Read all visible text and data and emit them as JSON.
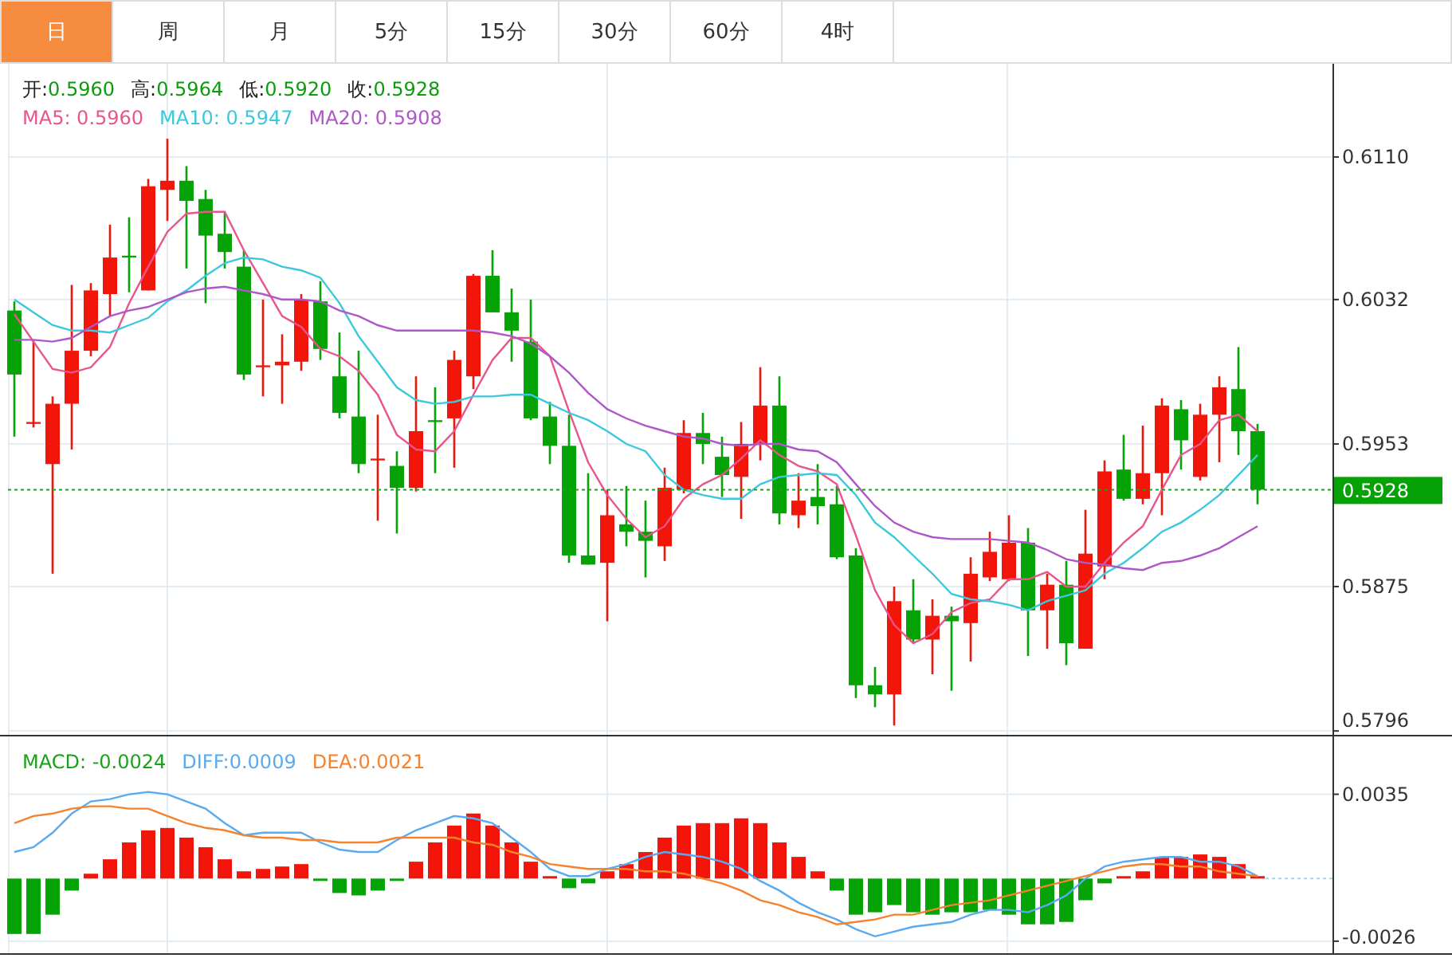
{
  "tabs": [
    {
      "label": "日",
      "selected": true
    },
    {
      "label": "周",
      "selected": false
    },
    {
      "label": "月",
      "selected": false
    },
    {
      "label": "5分",
      "selected": false
    },
    {
      "label": "15分",
      "selected": false
    },
    {
      "label": "30分",
      "selected": false
    },
    {
      "label": "60分",
      "selected": false
    },
    {
      "label": "4时",
      "selected": false
    }
  ],
  "price_chart": {
    "ohlc_legend": [
      {
        "label": "开:",
        "value": "0.5960"
      },
      {
        "label": "高:",
        "value": "0.5964"
      },
      {
        "label": "低:",
        "value": "0.5920"
      },
      {
        "label": "收:",
        "value": "0.5928"
      }
    ],
    "ma_legend": [
      {
        "value": ": 0.5960",
        "color": "#e8558c"
      },
      {
        "value": ": 0.5947",
        "color": "#3cc8dc"
      },
      {
        "value": ": 0.5908",
        "color": "#b057c8"
      }
    ],
    "chart_data": {
      "type": "candlestick",
      "ylim": [
        0.5793,
        0.6161
      ],
      "grid": true,
      "yticks": [
        {
          "value": 0.611,
          "label": "0.6110"
        },
        0.6032,
        0.5953,
        0.5875,
        0.5796
      ],
      "ref_lines": [
        {
          "axis": "y",
          "value": 0.5928,
          "label": "0.5928",
          "color": "#1aa31a"
        }
      ],
      "ohlc": [
        [
          0.6026,
          0.6031,
          0.5957,
          0.5991
        ],
        [
          0.5964,
          0.601,
          0.5962,
          0.5965
        ],
        [
          0.5942,
          0.5979,
          0.5882,
          0.5975
        ],
        [
          0.5975,
          0.604,
          0.595,
          0.6004
        ],
        [
          0.6004,
          0.6041,
          0.6001,
          0.6037
        ],
        [
          0.6035,
          0.6073,
          0.6023,
          0.6055
        ],
        [
          0.6056,
          0.6077,
          0.6036,
          0.6055
        ],
        [
          0.6037,
          0.6098,
          0.6037,
          0.6094
        ],
        [
          0.6092,
          0.612,
          0.6075,
          0.6097
        ],
        [
          0.6097,
          0.6105,
          0.6049,
          0.6086
        ],
        [
          0.6087,
          0.6092,
          0.603,
          0.6067
        ],
        [
          0.6068,
          0.608,
          0.6049,
          0.6058
        ],
        [
          0.605,
          0.6059,
          0.5988,
          0.5991
        ],
        [
          0.5995,
          0.6032,
          0.5979,
          0.5996
        ],
        [
          0.5996,
          0.6013,
          0.5975,
          0.5998
        ],
        [
          0.5998,
          0.6035,
          0.5993,
          0.6032
        ],
        [
          0.6031,
          0.6042,
          0.5999,
          0.6005
        ],
        [
          0.599,
          0.6014,
          0.5967,
          0.597
        ],
        [
          0.5968,
          0.6004,
          0.5937,
          0.5942
        ],
        [
          0.5944,
          0.5969,
          0.5911,
          0.5945
        ],
        [
          0.5941,
          0.5949,
          0.5904,
          0.5929
        ],
        [
          0.5929,
          0.599,
          0.5927,
          0.596
        ],
        [
          0.5966,
          0.5984,
          0.5937,
          0.5965
        ],
        [
          0.5967,
          0.6004,
          0.594,
          0.5999
        ],
        [
          0.599,
          0.6046,
          0.5983,
          0.6045
        ],
        [
          0.6045,
          0.6059,
          0.6025,
          0.6025
        ],
        [
          0.6025,
          0.6038,
          0.5998,
          0.6015
        ],
        [
          0.6009,
          0.6032,
          0.5966,
          0.5967
        ],
        [
          0.5968,
          0.5976,
          0.5942,
          0.5952
        ],
        [
          0.5952,
          0.5969,
          0.5888,
          0.5892
        ],
        [
          0.5892,
          0.5937,
          0.5887,
          0.5887
        ],
        [
          0.5888,
          0.5928,
          0.5856,
          0.5914
        ],
        [
          0.5909,
          0.593,
          0.5897,
          0.5905
        ],
        [
          0.5905,
          0.5922,
          0.588,
          0.59
        ],
        [
          0.5897,
          0.594,
          0.5889,
          0.5929
        ],
        [
          0.5928,
          0.5966,
          0.5926,
          0.5959
        ],
        [
          0.5959,
          0.597,
          0.5942,
          0.5953
        ],
        [
          0.5946,
          0.5957,
          0.5924,
          0.5936
        ],
        [
          0.5935,
          0.5965,
          0.5912,
          0.5953
        ],
        [
          0.5953,
          0.5995,
          0.5944,
          0.5974
        ],
        [
          0.5974,
          0.599,
          0.5909,
          0.5915
        ],
        [
          0.5914,
          0.5937,
          0.5907,
          0.5922
        ],
        [
          0.5924,
          0.5942,
          0.5909,
          0.5919
        ],
        [
          0.592,
          0.593,
          0.589,
          0.5891
        ],
        [
          0.5892,
          0.5896,
          0.5814,
          0.5821
        ],
        [
          0.5821,
          0.5831,
          0.5809,
          0.5816
        ],
        [
          0.5816,
          0.5875,
          0.5799,
          0.5867
        ],
        [
          0.5862,
          0.5879,
          0.5844,
          0.5846
        ],
        [
          0.5846,
          0.5868,
          0.5827,
          0.5859
        ],
        [
          0.5859,
          0.5864,
          0.5818,
          0.5856
        ],
        [
          0.5855,
          0.5891,
          0.5834,
          0.5882
        ],
        [
          0.588,
          0.5905,
          0.5878,
          0.5894
        ],
        [
          0.5879,
          0.5914,
          0.5878,
          0.5899
        ],
        [
          0.5899,
          0.5907,
          0.5837,
          0.5862
        ],
        [
          0.5862,
          0.5882,
          0.5841,
          0.5876
        ],
        [
          0.5876,
          0.5889,
          0.5832,
          0.5844
        ],
        [
          0.5841,
          0.5917,
          0.5841,
          0.5893
        ],
        [
          0.5886,
          0.5944,
          0.5879,
          0.5938
        ],
        [
          0.5939,
          0.5958,
          0.5922,
          0.5923
        ],
        [
          0.5923,
          0.5963,
          0.592,
          0.5937
        ],
        [
          0.5937,
          0.5978,
          0.5914,
          0.5974
        ],
        [
          0.5972,
          0.5977,
          0.5939,
          0.5955
        ],
        [
          0.5935,
          0.5975,
          0.5933,
          0.5969
        ],
        [
          0.5969,
          0.599,
          0.5943,
          0.5984
        ],
        [
          0.5983,
          0.6006,
          0.5947,
          0.596
        ],
        [
          0.596,
          0.5964,
          0.592,
          0.5928
        ]
      ],
      "series": [
        {
          "name": "MA5",
          "type": "line",
          "color": "#e8558c",
          "values": [
            0.6024,
            0.6009,
            0.5994,
            0.5992,
            0.5995,
            0.6006,
            0.603,
            0.605,
            0.6069,
            0.6079,
            0.608,
            0.608,
            0.6059,
            0.6041,
            0.6023,
            0.6017,
            0.6005,
            0.6001,
            0.5993,
            0.598,
            0.5958,
            0.595,
            0.5949,
            0.596,
            0.598,
            0.5999,
            0.6011,
            0.6011,
            0.6001,
            0.5971,
            0.5943,
            0.5925,
            0.5912,
            0.5902,
            0.5908,
            0.5923,
            0.5931,
            0.5936,
            0.5945,
            0.5955,
            0.5947,
            0.5941,
            0.5938,
            0.5931,
            0.5903,
            0.5873,
            0.5854,
            0.5844,
            0.5849,
            0.5861,
            0.5866,
            0.5868,
            0.5879,
            0.5879,
            0.5883,
            0.5875,
            0.5875,
            0.5888,
            0.5899,
            0.5908,
            0.5928,
            0.5947,
            0.5953,
            0.5966,
            0.5969,
            0.596
          ]
        },
        {
          "name": "MA10",
          "type": "line",
          "color": "#3cc8dc",
          "values": [
            0.6032,
            0.6025,
            0.6018,
            0.6015,
            0.6015,
            0.6014,
            0.6018,
            0.6022,
            0.6031,
            0.6037,
            0.6045,
            0.6052,
            0.6055,
            0.6054,
            0.605,
            0.6048,
            0.6044,
            0.603,
            0.6012,
            0.5998,
            0.5984,
            0.5977,
            0.5975,
            0.5976,
            0.5979,
            0.5979,
            0.598,
            0.598,
            0.5975,
            0.597,
            0.5966,
            0.596,
            0.5953,
            0.5949,
            0.5936,
            0.5928,
            0.5925,
            0.5923,
            0.5923,
            0.5931,
            0.5935,
            0.5936,
            0.5937,
            0.5936,
            0.5925,
            0.591,
            0.5902,
            0.5892,
            0.5882,
            0.5871,
            0.5868,
            0.5867,
            0.5865,
            0.5862,
            0.5867,
            0.587,
            0.5873,
            0.5882,
            0.5888,
            0.5896,
            0.5905,
            0.591,
            0.5917,
            0.5925,
            0.5936,
            0.5947
          ]
        },
        {
          "name": "MA20",
          "type": "line",
          "color": "#b057c8",
          "values": [
            0.601,
            0.601,
            0.6009,
            0.6011,
            0.6017,
            0.6023,
            0.6026,
            0.6028,
            0.6032,
            0.6036,
            0.6038,
            0.6039,
            0.6037,
            0.6035,
            0.6032,
            0.6032,
            0.6031,
            0.6026,
            0.6023,
            0.6018,
            0.6015,
            0.6015,
            0.6015,
            0.6015,
            0.6015,
            0.6014,
            0.6012,
            0.6008,
            0.6001,
            0.5992,
            0.5981,
            0.5972,
            0.5967,
            0.5963,
            0.596,
            0.5957,
            0.5956,
            0.5953,
            0.5952,
            0.5953,
            0.5953,
            0.595,
            0.5949,
            0.5943,
            0.5931,
            0.5919,
            0.591,
            0.5905,
            0.5902,
            0.5901,
            0.5901,
            0.5901,
            0.59,
            0.5899,
            0.5895,
            0.589,
            0.5888,
            0.5887,
            0.5885,
            0.5884,
            0.5888,
            0.5889,
            0.5892,
            0.5896,
            0.5902,
            0.5908
          ]
        }
      ]
    }
  },
  "macd_chart": {
    "legend": [
      {
        "value": ": -0.0024",
        "color": "#1aa31a"
      },
      {
        "value": ":0.0009",
        "color": "#5aaaf0"
      },
      {
        "value": ":0.0021",
        "color": "#f5822d"
      }
    ],
    "chart_data": {
      "type": "bar",
      "ylim": [
        -0.0031,
        0.0059
      ],
      "grid": true,
      "yticks": [
        0.0035,
        -0.0026
      ],
      "series": [
        {
          "name": "MACD",
          "type": "bar",
          "colors": [
            "#05a305",
            "#05a305",
            "#05a305",
            "#05a305",
            "#f2150a",
            "#f2150a",
            "#f2150a",
            "#f2150a",
            "#f2150a",
            "#f2150a",
            "#f2150a",
            "#f2150a",
            "#f2150a",
            "#f2150a",
            "#f2150a",
            "#f2150a",
            "#05a305",
            "#05a305",
            "#05a305",
            "#05a305",
            "#05a305",
            "#f2150a",
            "#f2150a",
            "#f2150a",
            "#f2150a",
            "#f2150a",
            "#f2150a",
            "#f2150a",
            "#f2150a",
            "#05a305",
            "#05a305",
            "#f2150a",
            "#f2150a",
            "#f2150a",
            "#f2150a",
            "#f2150a",
            "#f2150a",
            "#f2150a",
            "#f2150a",
            "#f2150a",
            "#f2150a",
            "#f2150a",
            "#f2150a",
            "#05a305",
            "#05a305",
            "#05a305",
            "#05a305",
            "#05a305",
            "#05a305",
            "#05a305",
            "#05a305",
            "#05a305",
            "#05a305",
            "#05a305",
            "#05a305",
            "#05a305",
            "#05a305",
            "#05a305",
            "#f2150a",
            "#f2150a",
            "#f2150a",
            "#f2150a",
            "#f2150a",
            "#f2150a",
            "#f2150a",
            "#f2150a"
          ],
          "values": [
            -0.0023,
            -0.0023,
            -0.0015,
            -0.0005,
            0.0002,
            0.0008,
            0.0015,
            0.002,
            0.0021,
            0.0017,
            0.0013,
            0.0008,
            0.0003,
            0.0004,
            0.0005,
            0.0006,
            -0.0001,
            -0.0006,
            -0.0007,
            -0.0005,
            -0.0001,
            0.0007,
            0.0015,
            0.0022,
            0.0027,
            0.0022,
            0.0015,
            0.0007,
            0.0001,
            -0.0004,
            -0.0002,
            0.0003,
            0.0006,
            0.0011,
            0.0017,
            0.0022,
            0.0023,
            0.0023,
            0.0025,
            0.0023,
            0.0015,
            0.0009,
            0.0003,
            -0.0005,
            -0.0015,
            -0.0014,
            -0.0011,
            -0.0014,
            -0.0015,
            -0.0014,
            -0.0014,
            -0.0013,
            -0.0015,
            -0.0019,
            -0.0019,
            -0.0018,
            -0.0009,
            -0.0002,
            0.0001,
            0.0003,
            0.0009,
            0.0009,
            0.001,
            0.0009,
            0.0006,
            0.0001
          ]
        },
        {
          "name": "DIFF",
          "type": "line",
          "color": "#5aaaf0",
          "values": [
            0.0011,
            0.0013,
            0.0019,
            0.0027,
            0.0032,
            0.0033,
            0.0035,
            0.0036,
            0.0035,
            0.0032,
            0.0029,
            0.0023,
            0.0018,
            0.0019,
            0.0019,
            0.0019,
            0.0015,
            0.0012,
            0.0011,
            0.0011,
            0.0016,
            0.002,
            0.0023,
            0.0026,
            0.0025,
            0.0023,
            0.0017,
            0.0011,
            0.0004,
            0.0001,
            0.0001,
            0.0004,
            0.0006,
            0.0009,
            0.0011,
            0.001,
            0.0009,
            0.0007,
            0.0004,
            -0.0001,
            -0.0005,
            -0.001,
            -0.0014,
            -0.0017,
            -0.0021,
            -0.0024,
            -0.0022,
            -0.002,
            -0.0019,
            -0.0018,
            -0.0015,
            -0.0013,
            -0.0013,
            -0.0014,
            -0.0011,
            -0.0007,
            0,
            0.0005,
            0.0007,
            0.0008,
            0.0009,
            0.0009,
            0.0007,
            0.0007,
            0.0005,
            0.0001
          ]
        },
        {
          "name": "DEA",
          "type": "line",
          "color": "#f5822d",
          "values": [
            0.0023,
            0.0026,
            0.0027,
            0.0029,
            0.003,
            0.003,
            0.0029,
            0.0029,
            0.0026,
            0.0023,
            0.0021,
            0.002,
            0.0018,
            0.0017,
            0.0017,
            0.0016,
            0.0016,
            0.0015,
            0.0015,
            0.0015,
            0.0017,
            0.0017,
            0.0017,
            0.0017,
            0.0015,
            0.0014,
            0.0011,
            0.0009,
            0.0006,
            0.0005,
            0.0004,
            0.0004,
            0.0004,
            0.0003,
            0.0003,
            0.0002,
            0,
            -0.0002,
            -0.0005,
            -0.0009,
            -0.0011,
            -0.0014,
            -0.0016,
            -0.0019,
            -0.0018,
            -0.0017,
            -0.0015,
            -0.0015,
            -0.0013,
            -0.0011,
            -0.001,
            -0.0009,
            -0.0007,
            -0.0005,
            -0.0003,
            -0.0001,
            0.0001,
            0.0003,
            0.0005,
            0.0006,
            0.0006,
            0.0005,
            0.0005,
            0.0003,
            0.0002,
            0.0001
          ]
        }
      ]
    }
  }
}
